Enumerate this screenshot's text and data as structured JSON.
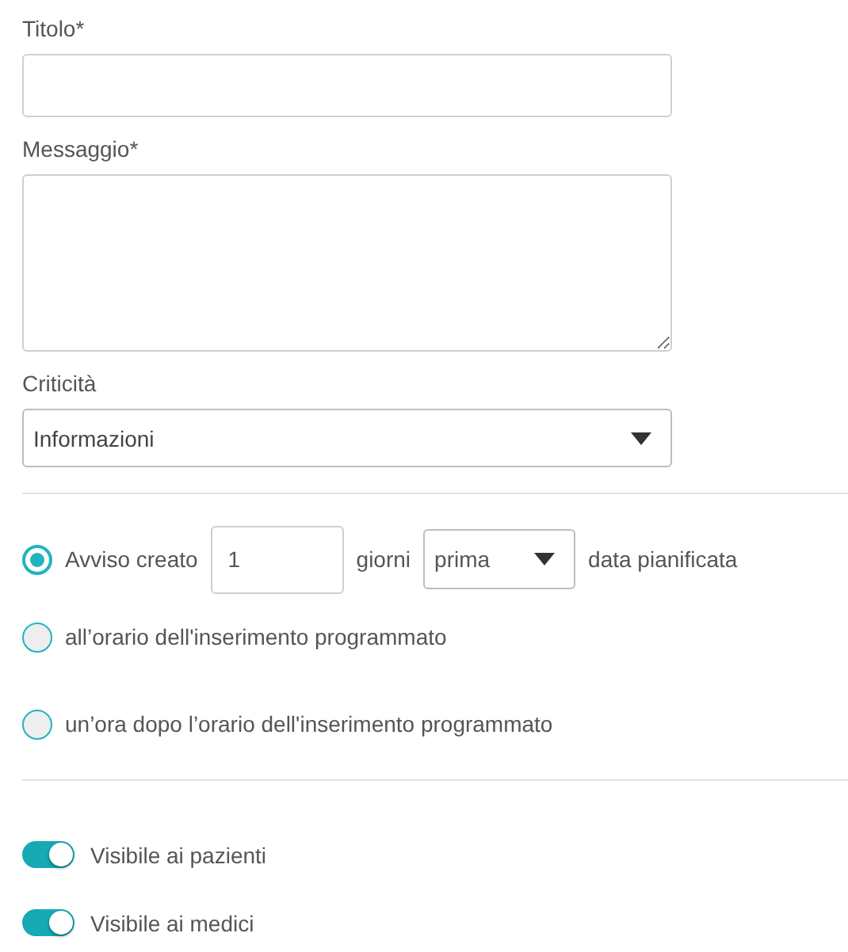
{
  "fields": [
    {
      "kind": "input",
      "label": "Titolo*"
    },
    {
      "kind": "textarea",
      "label": "Messaggio*"
    },
    {
      "kind": "select",
      "label": "Criticità",
      "value": "Informazioni"
    }
  ],
  "timing_options": [
    {
      "kind": "compound",
      "selected": true,
      "prefix": "Avviso creato",
      "days": "1",
      "unit": "giorni",
      "relation": "prima",
      "suffix": "data pianificata"
    },
    {
      "kind": "plain",
      "selected": false,
      "label": "all’orario dell'inserimento programmato"
    },
    {
      "kind": "plain",
      "selected": false,
      "label": "un’ora dopo l’orario dell'inserimento programmato"
    }
  ],
  "visibility": [
    {
      "label": "Visibile ai pazienti",
      "on": true
    },
    {
      "label": "Visibile ai medici",
      "on": true
    }
  ]
}
